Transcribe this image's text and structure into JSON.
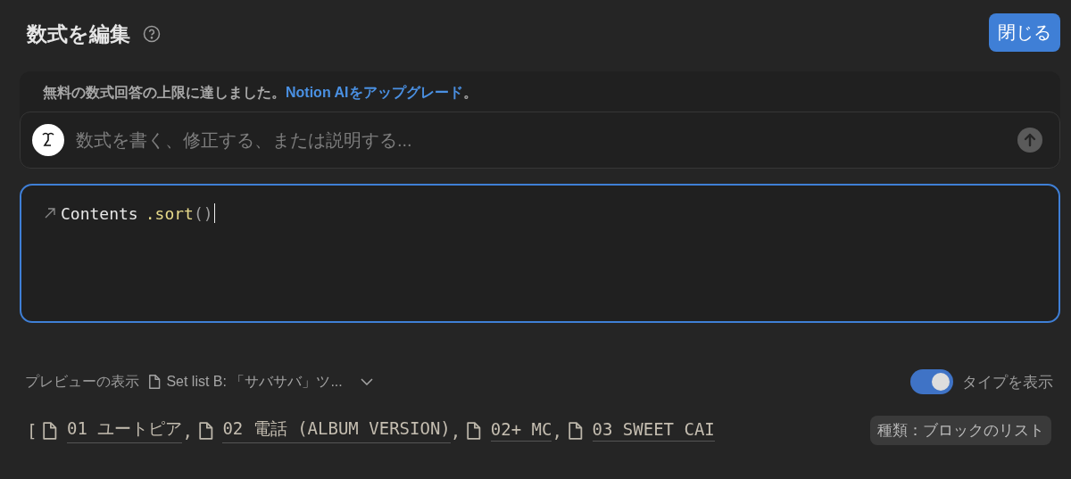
{
  "header": {
    "title": "数式を編集",
    "close_button": "閉じる"
  },
  "ai_panel": {
    "notice": "無料の数式回答の上限に達しました。",
    "notice_link": "Notion AIをアップグレード",
    "notice_end": "。",
    "placeholder": "数式を書く、修正する、または説明する..."
  },
  "formula": {
    "tokens": [
      {
        "kind": "property",
        "text": "Contents"
      },
      {
        "kind": "method",
        "text": ".sort"
      },
      {
        "kind": "paren",
        "text": "()"
      }
    ]
  },
  "preview": {
    "label": "プレビューの表示",
    "page": "Set list B: 「サバサバ」ツ...",
    "toggle_label": "タイプを表示",
    "toggle_on": true
  },
  "result": {
    "open_bracket": "[",
    "items": [
      {
        "text": "01 ユートピア",
        "separator": ","
      },
      {
        "text": "02 電話 (ALBUM VERSION)",
        "separator": ","
      },
      {
        "text": "02+ MC",
        "separator": ","
      },
      {
        "text": "03 SWEET CAI"
      }
    ],
    "type_badge": "種類：ブロックのリスト"
  }
}
